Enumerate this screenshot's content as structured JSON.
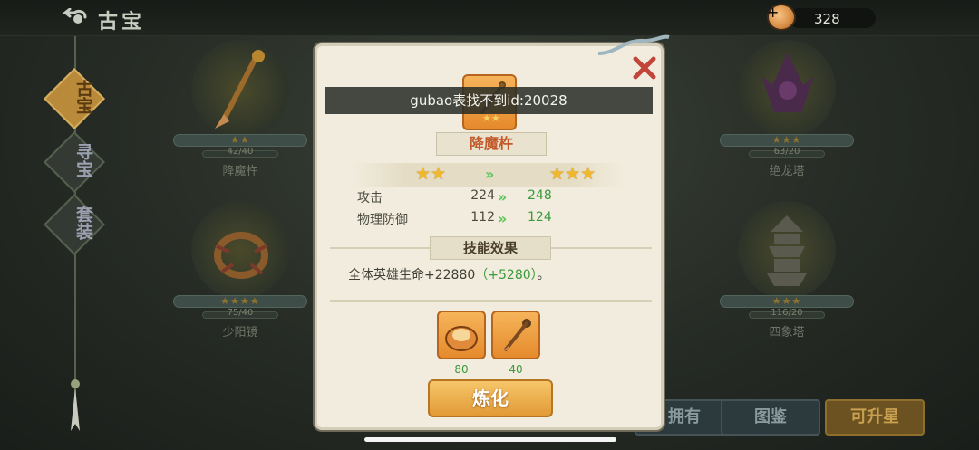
{
  "header": {
    "title": "古宝",
    "currency_amount": "328",
    "add_label": "+"
  },
  "side_nav": {
    "items": [
      {
        "label": "古宝",
        "active": true
      },
      {
        "label": "寻宝",
        "active": false
      },
      {
        "label": "套装",
        "active": false
      }
    ]
  },
  "background_cards": [
    {
      "name": "降魔杵",
      "stars": "★★",
      "count": "42/40"
    },
    {
      "name": "少阳镜",
      "stars": "★★★★",
      "count": "75/40"
    },
    {
      "name": "绝龙塔",
      "stars": "★★★",
      "count": "63/20"
    },
    {
      "name": "四象塔",
      "stars": "★★★",
      "count": "116/20"
    }
  ],
  "bottom_tabs": [
    {
      "label": "拥有",
      "active": false
    },
    {
      "label": "图鉴",
      "active": false
    },
    {
      "label": "可升星",
      "active": true
    }
  ],
  "popup": {
    "item_name": "降魔杵",
    "stars_from": "★★",
    "stars_to": "★★★",
    "stats": [
      {
        "label": "攻击",
        "old": "224",
        "new": "248"
      },
      {
        "label": "物理防御",
        "old": "112",
        "new": "124"
      }
    ],
    "skill_section_title": "技能效果",
    "skill_desc_main": "全体英雄生命+22880",
    "skill_desc_bonus": "（+5280）",
    "skill_desc_end": "。",
    "materials": [
      {
        "icon": "coin-pouch-icon",
        "count": "80"
      },
      {
        "icon": "demon-pestle-icon",
        "count": "40"
      }
    ],
    "refine_label": "炼化"
  },
  "toast": {
    "message": "gubao表找不到id:20028"
  },
  "colors": {
    "accent_orange": "#e58a2c",
    "increase_green": "#3a9a3a",
    "item_name_red": "#c25a2a"
  }
}
